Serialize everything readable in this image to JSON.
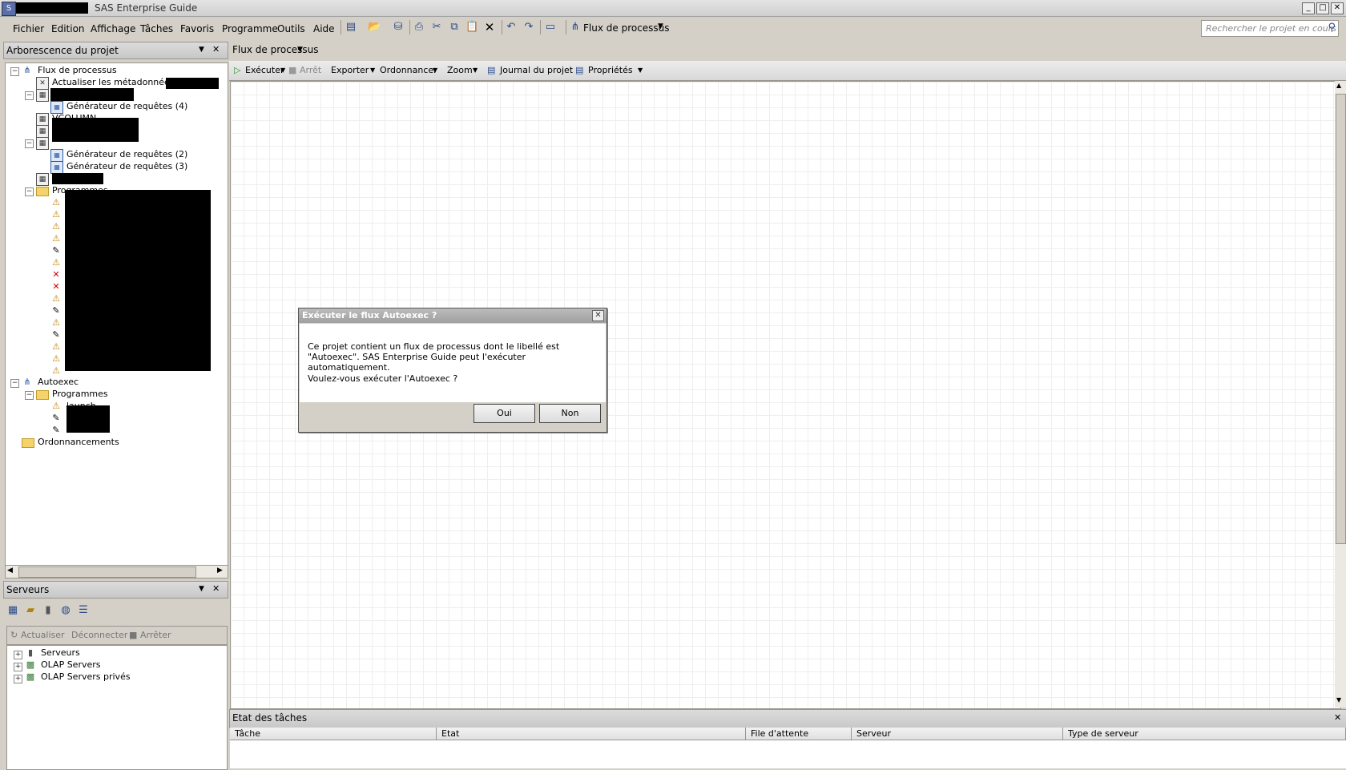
{
  "window": {
    "title": "SAS Enterprise Guide"
  },
  "menu": [
    "Fichier",
    "Edition",
    "Affichage",
    "Tâches",
    "Favoris",
    "Programme",
    "Outils",
    "Aide"
  ],
  "toolbar": {
    "flow_label": "Flux de processus"
  },
  "search": {
    "placeholder": "Rechercher le projet en cours"
  },
  "project_panel": {
    "title": "Arborescence du projet",
    "root_label": "Flux de processus",
    "metadata_item": "Actualiser les métadonnées de \"",
    "query_4": "Générateur de requêtes (4)",
    "vcolumn": "VCOLUMN",
    "query_2": "Générateur de requêtes (2)",
    "query_3": "Générateur de requêtes (3)",
    "programs": "Programmes",
    "autoexec": "Autoexec",
    "autoexec_programs": "Programmes",
    "launch": "launch",
    "schedules": "Ordonnancements"
  },
  "servers_panel": {
    "title": "Serveurs",
    "refresh": "Actualiser",
    "disconnect": "Déconnecter",
    "stop": "Arrêter",
    "items": [
      "Serveurs",
      "OLAP Servers",
      "OLAP Servers privés"
    ]
  },
  "flow_tab": {
    "label": "Flux de processus"
  },
  "flow_toolbar": {
    "run": "Exécuter",
    "stop": "Arrêt",
    "export": "Exporter",
    "schedule": "Ordonnancer",
    "zoom": "Zoom",
    "log": "Journal du projet",
    "properties": "Propriétés"
  },
  "task_status": {
    "title": "Etat des tâches",
    "columns": [
      "Tâche",
      "Etat",
      "File d'attente",
      "Serveur",
      "Type de serveur"
    ]
  },
  "dialog": {
    "title": "Exécuter le flux Autoexec ?",
    "line1": "Ce projet contient un flux de processus dont le libellé est \"Autoexec\".  SAS Enterprise Guide peut l'exécuter automatiquement.",
    "line2": "Voulez-vous exécuter l'Autoexec ?",
    "yes": "Oui",
    "no": "Non"
  }
}
